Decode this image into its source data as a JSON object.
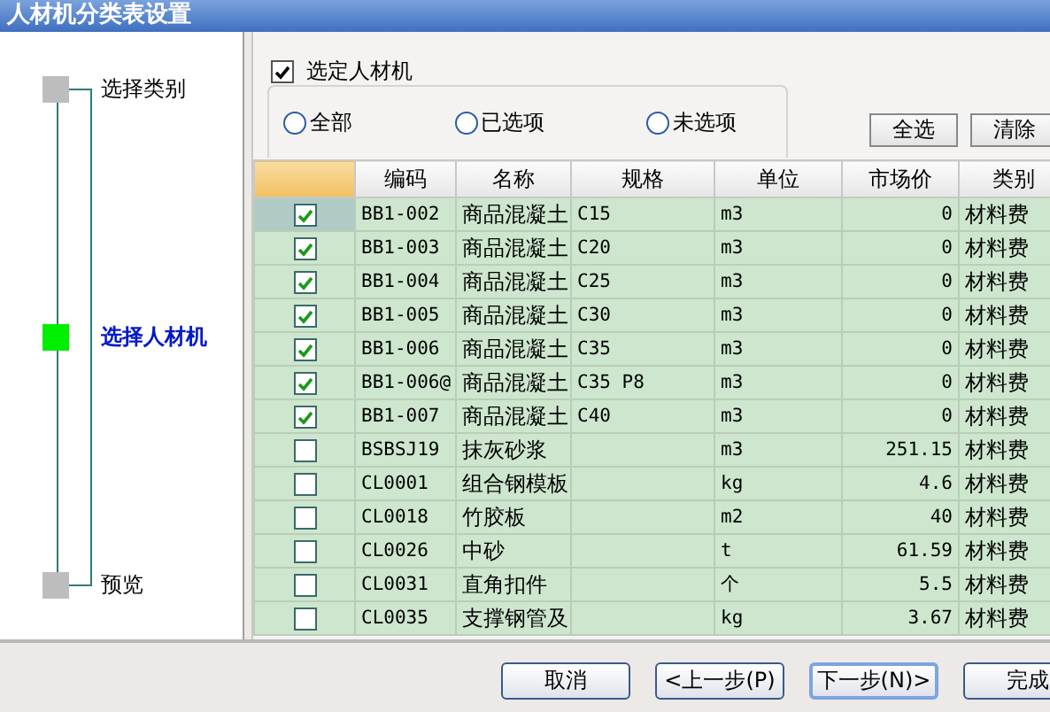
{
  "window": {
    "title": "人材机分类表设置"
  },
  "steps": [
    {
      "label": "选择类别",
      "selected": false
    },
    {
      "label": "选择人材机",
      "selected": true
    },
    {
      "label": "预览",
      "selected": false
    }
  ],
  "select_checkbox": {
    "label": "选定人材机",
    "checked": true
  },
  "filter": [
    {
      "label": "全部",
      "selected": false
    },
    {
      "label": "已选项",
      "selected": false
    },
    {
      "label": "未选项",
      "selected": false
    }
  ],
  "toolbar_buttons": [
    "全选",
    "清除"
  ],
  "table": {
    "columns": [
      "编码",
      "名称",
      "规格",
      "单位",
      "市场价",
      "类别"
    ],
    "rows": [
      {
        "selected": true,
        "checked": true,
        "code": "BB1-002",
        "name": "商品混凝土",
        "spec": "C15",
        "unit": "m3",
        "price": "0",
        "category": "材料费"
      },
      {
        "selected": false,
        "checked": true,
        "code": "BB1-003",
        "name": "商品混凝土",
        "spec": "C20",
        "unit": "m3",
        "price": "0",
        "category": "材料费"
      },
      {
        "selected": false,
        "checked": true,
        "code": "BB1-004",
        "name": "商品混凝土",
        "spec": "C25",
        "unit": "m3",
        "price": "0",
        "category": "材料费"
      },
      {
        "selected": false,
        "checked": true,
        "code": "BB1-005",
        "name": "商品混凝土",
        "spec": "C30",
        "unit": "m3",
        "price": "0",
        "category": "材料费"
      },
      {
        "selected": false,
        "checked": true,
        "code": "BB1-006",
        "name": "商品混凝土",
        "spec": "C35",
        "unit": "m3",
        "price": "0",
        "category": "材料费"
      },
      {
        "selected": false,
        "checked": true,
        "code": "BB1-006@",
        "name": "商品混凝土",
        "spec": "C35 P8",
        "unit": "m3",
        "price": "0",
        "category": "材料费"
      },
      {
        "selected": false,
        "checked": true,
        "code": "BB1-007",
        "name": "商品混凝土",
        "spec": "C40",
        "unit": "m3",
        "price": "0",
        "category": "材料费"
      },
      {
        "selected": false,
        "checked": false,
        "code": "BSBSJ19",
        "name": "抹灰砂浆",
        "unit": "m3",
        "price": "251.15",
        "category": "材料费"
      },
      {
        "selected": false,
        "checked": false,
        "code": "CL0001",
        "name": "组合钢模板",
        "unit": "kg",
        "price": "4.6",
        "category": "材料费"
      },
      {
        "selected": false,
        "checked": false,
        "code": "CL0018",
        "name": "竹胶板",
        "unit": "m2",
        "price": "40",
        "category": "材料费"
      },
      {
        "selected": false,
        "checked": false,
        "code": "CL0026",
        "name": "中砂",
        "unit": "t",
        "price": "61.59",
        "category": "材料费"
      },
      {
        "selected": false,
        "checked": false,
        "code": "CL0031",
        "name": "直角扣件",
        "unit": "个",
        "price": "5.5",
        "category": "材料费"
      },
      {
        "selected": false,
        "checked": false,
        "code": "CL0035",
        "name": "支撑钢管及",
        "unit": "kg",
        "price": "3.67",
        "category": "材料费"
      }
    ]
  },
  "buttons": [
    {
      "label": "取消",
      "focused": false
    },
    {
      "label": "<上一步(P)",
      "focused": false
    },
    {
      "label": "下一步(N)>",
      "focused": true
    },
    {
      "label": "完成",
      "focused": false
    }
  ]
}
